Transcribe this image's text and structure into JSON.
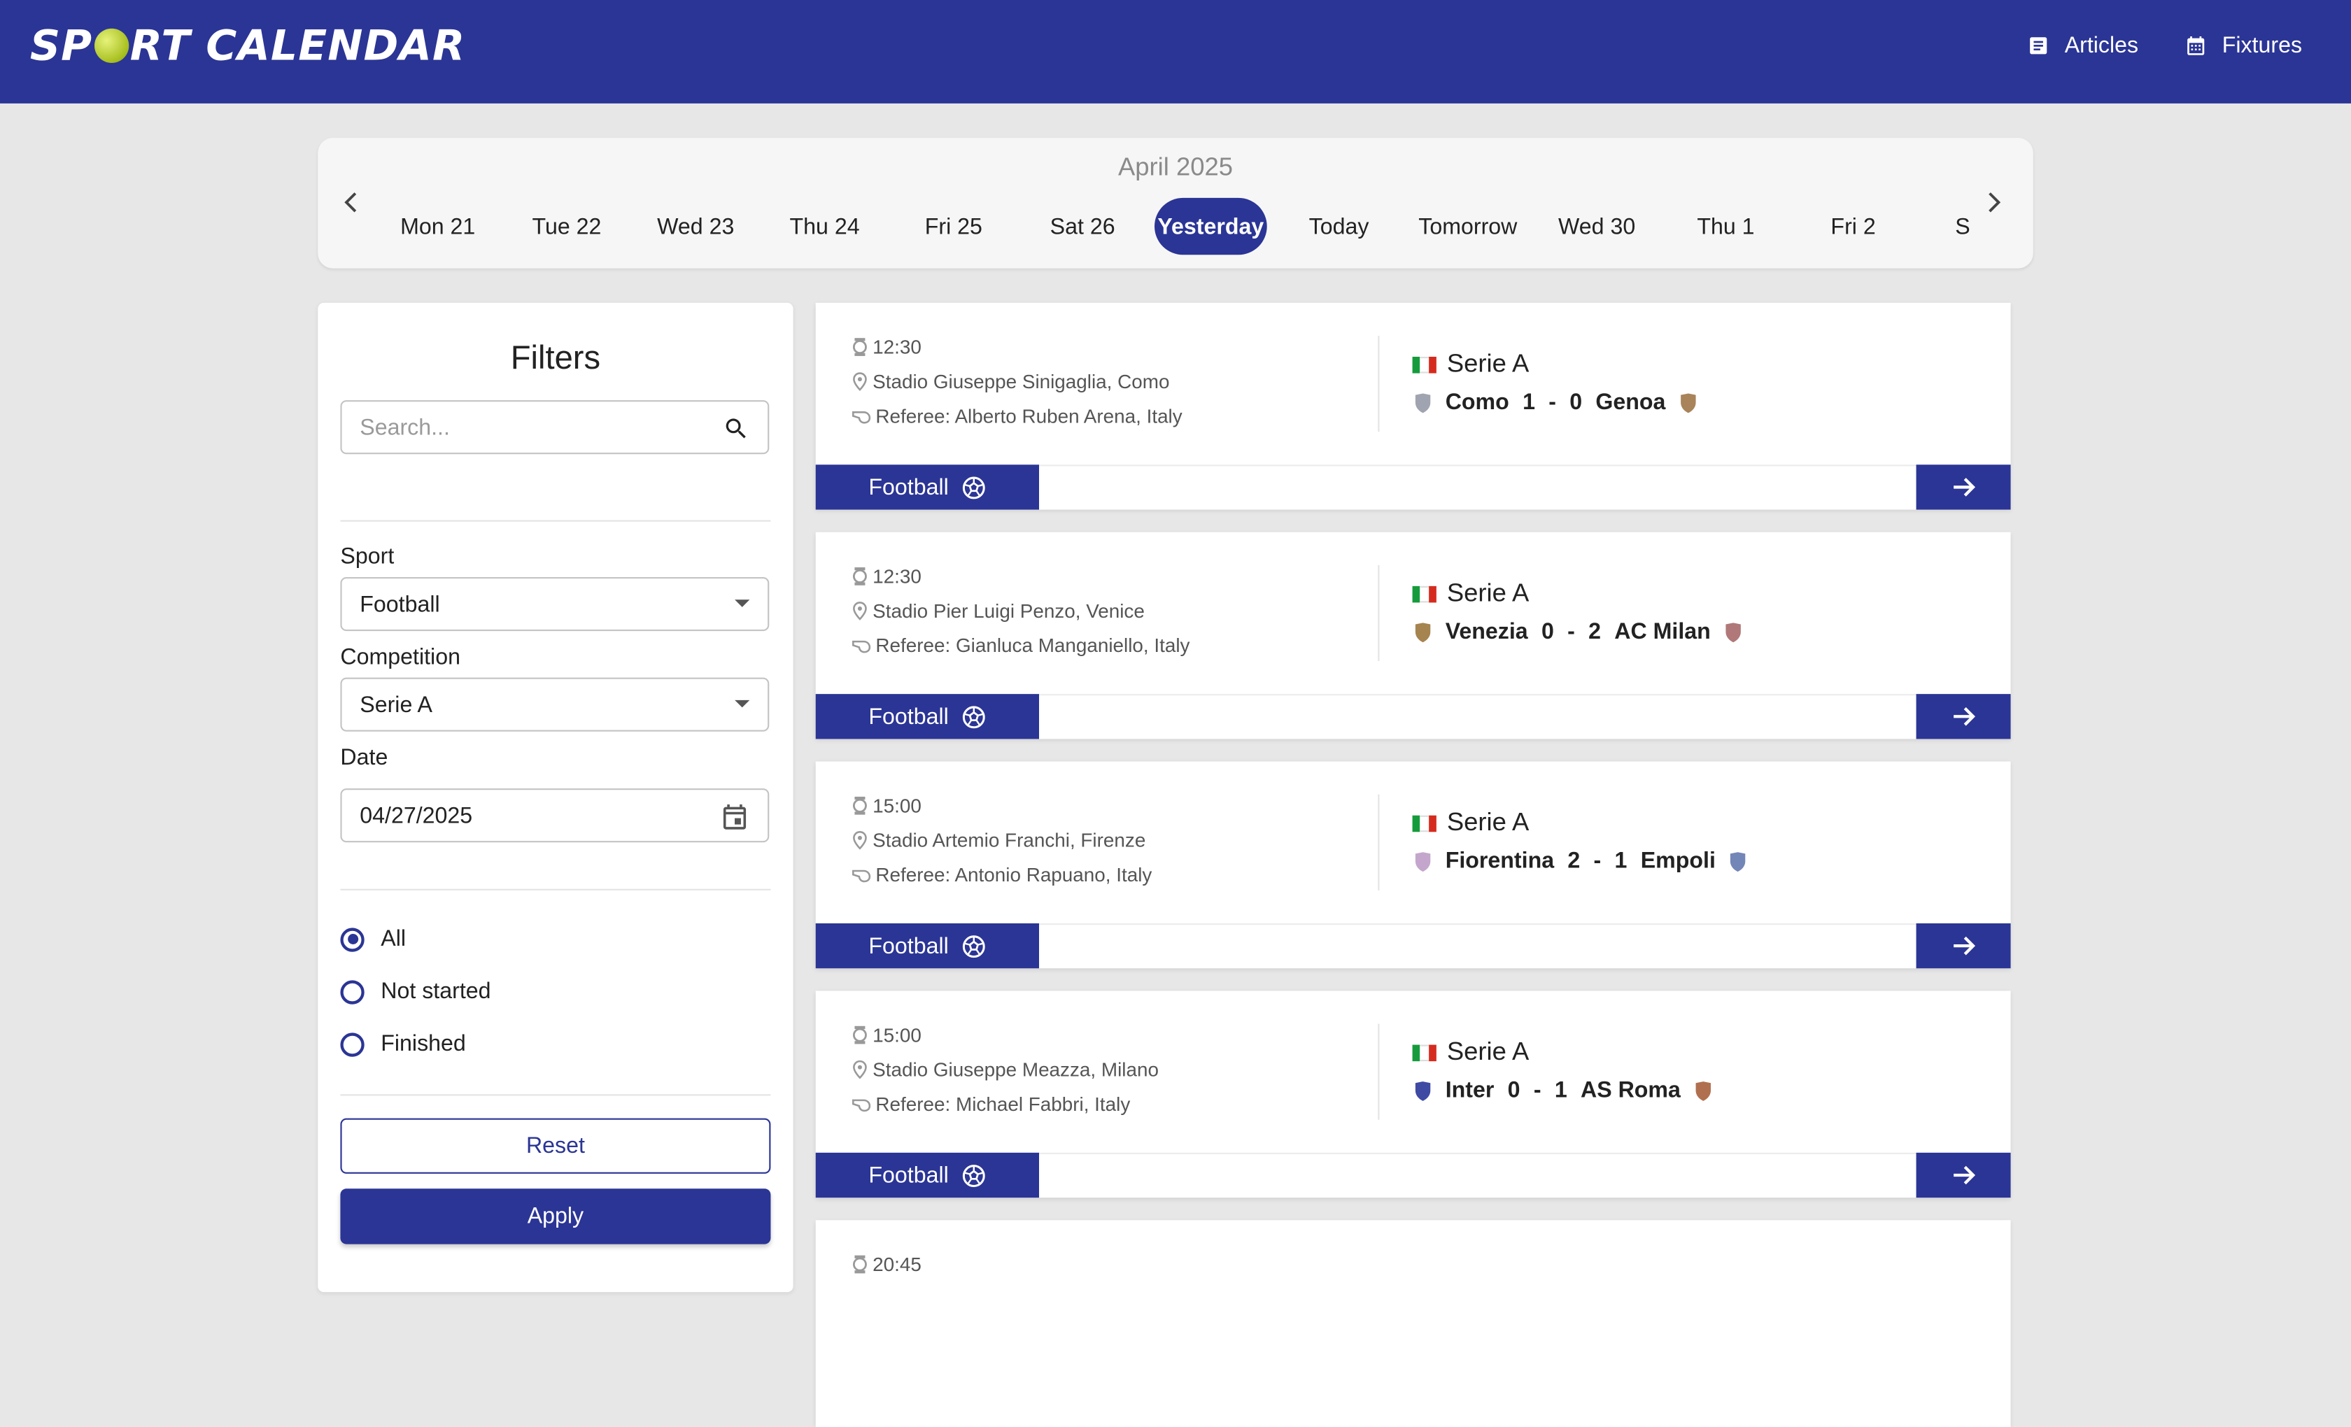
{
  "header": {
    "logo_text_before": "SP",
    "logo_text_after": "RT CALENDAR",
    "nav": [
      {
        "label": "Articles",
        "icon": "article-icon"
      },
      {
        "label": "Fixtures",
        "icon": "calendar-icon"
      }
    ]
  },
  "date_strip": {
    "month": "April 2025",
    "days": [
      "Mon 21",
      "Tue 22",
      "Wed 23",
      "Thu 24",
      "Fri 25",
      "Sat 26",
      "Yesterday",
      "Today",
      "Tomorrow",
      "Wed 30",
      "Thu 1",
      "Fri 2",
      "S"
    ],
    "selected": "Yesterday"
  },
  "filters": {
    "title": "Filters",
    "search_placeholder": "Search...",
    "sport_label": "Sport",
    "sport_value": "Football",
    "competition_label": "Competition",
    "competition_value": "Serie A",
    "date_label": "Date",
    "date_value": "04/27/2025",
    "status_options": [
      "All",
      "Not started",
      "Finished"
    ],
    "status_selected": "All",
    "reset_label": "Reset",
    "apply_label": "Apply"
  },
  "matches": [
    {
      "time": "12:30",
      "venue": "Stadio Giuseppe Sinigaglia, Como",
      "referee": "Referee: Alberto Ruben Arena, Italy",
      "competition": "Serie A",
      "home": "Como",
      "home_score": "1",
      "away_score": "0",
      "away": "Genoa",
      "home_color": "#a0a4b0",
      "away_color": "#a9835a",
      "sport": "Football"
    },
    {
      "time": "12:30",
      "venue": "Stadio Pier Luigi Penzo, Venice",
      "referee": "Referee: Gianluca Manganiello, Italy",
      "competition": "Serie A",
      "home": "Venezia",
      "home_score": "0",
      "away_score": "2",
      "away": "AC Milan",
      "home_color": "#a6844f",
      "away_color": "#b07878",
      "sport": "Football"
    },
    {
      "time": "15:00",
      "venue": "Stadio Artemio Franchi, Firenze",
      "referee": "Referee: Antonio Rapuano, Italy",
      "competition": "Serie A",
      "home": "Fiorentina",
      "home_score": "2",
      "away_score": "1",
      "away": "Empoli",
      "home_color": "#c4a6cc",
      "away_color": "#7386b8",
      "sport": "Football"
    },
    {
      "time": "15:00",
      "venue": "Stadio Giuseppe Meazza, Milano",
      "referee": "Referee: Michael Fabbri, Italy",
      "competition": "Serie A",
      "home": "Inter",
      "home_score": "0",
      "away_score": "1",
      "away": "AS Roma",
      "home_color": "#3f4aa3",
      "away_color": "#b0704f",
      "sport": "Football"
    },
    {
      "time": "20:45"
    }
  ],
  "colors": {
    "primary": "#2b3595",
    "background": "#e7e7e7"
  }
}
